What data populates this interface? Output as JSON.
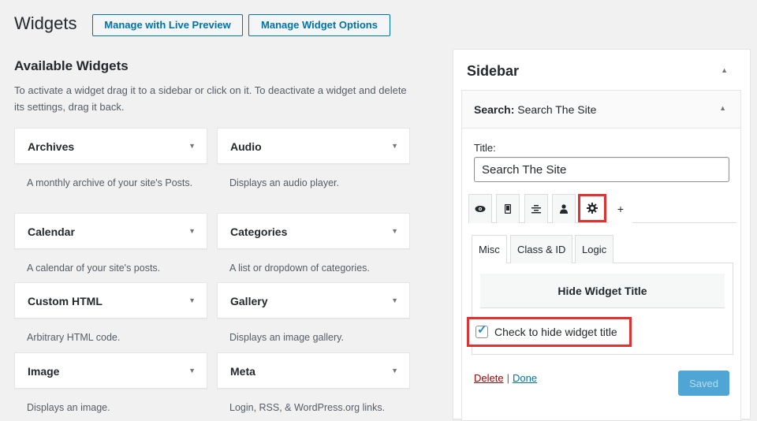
{
  "header": {
    "title": "Widgets",
    "live_preview_label": "Manage with Live Preview",
    "options_label": "Manage Widget Options"
  },
  "available": {
    "title": "Available Widgets",
    "description": "To activate a widget drag it to a sidebar or click on it. To deactivate a widget and delete its settings, drag it back.",
    "widgets": [
      {
        "name": "Archives",
        "desc": "A monthly archive of your site's Posts."
      },
      {
        "name": "Audio",
        "desc": "Displays an audio player."
      },
      {
        "name": "Calendar",
        "desc": "A calendar of your site's posts."
      },
      {
        "name": "Categories",
        "desc": "A list or dropdown of categories."
      },
      {
        "name": "Custom HTML",
        "desc": "Arbitrary HTML code."
      },
      {
        "name": "Gallery",
        "desc": "Displays an image gallery."
      },
      {
        "name": "Image",
        "desc": "Displays an image."
      },
      {
        "name": "Meta",
        "desc": "Login, RSS, & WordPress.org links."
      }
    ]
  },
  "sidebar": {
    "title": "Sidebar",
    "search_widget": {
      "type_label": "Search:",
      "instance_title": "Search The Site",
      "title_label": "Title:",
      "title_value": "Search The Site",
      "icon_tabs": [
        "eye-icon",
        "mobile-icon",
        "align-icon",
        "user-icon",
        "gear-icon",
        "plus-icon"
      ],
      "text_tabs": [
        "Misc",
        "Class & ID",
        "Logic"
      ],
      "hide_title_heading": "Hide Widget Title",
      "hide_title_checkbox_label": "Check to hide widget title",
      "hide_title_checked": true,
      "delete_label": "Delete",
      "separator": "|",
      "done_label": "Done",
      "saved_label": "Saved"
    }
  },
  "colors": {
    "accent": "#0073aa",
    "highlight": "#dd3333",
    "saved_button": "#4fa5d4"
  }
}
